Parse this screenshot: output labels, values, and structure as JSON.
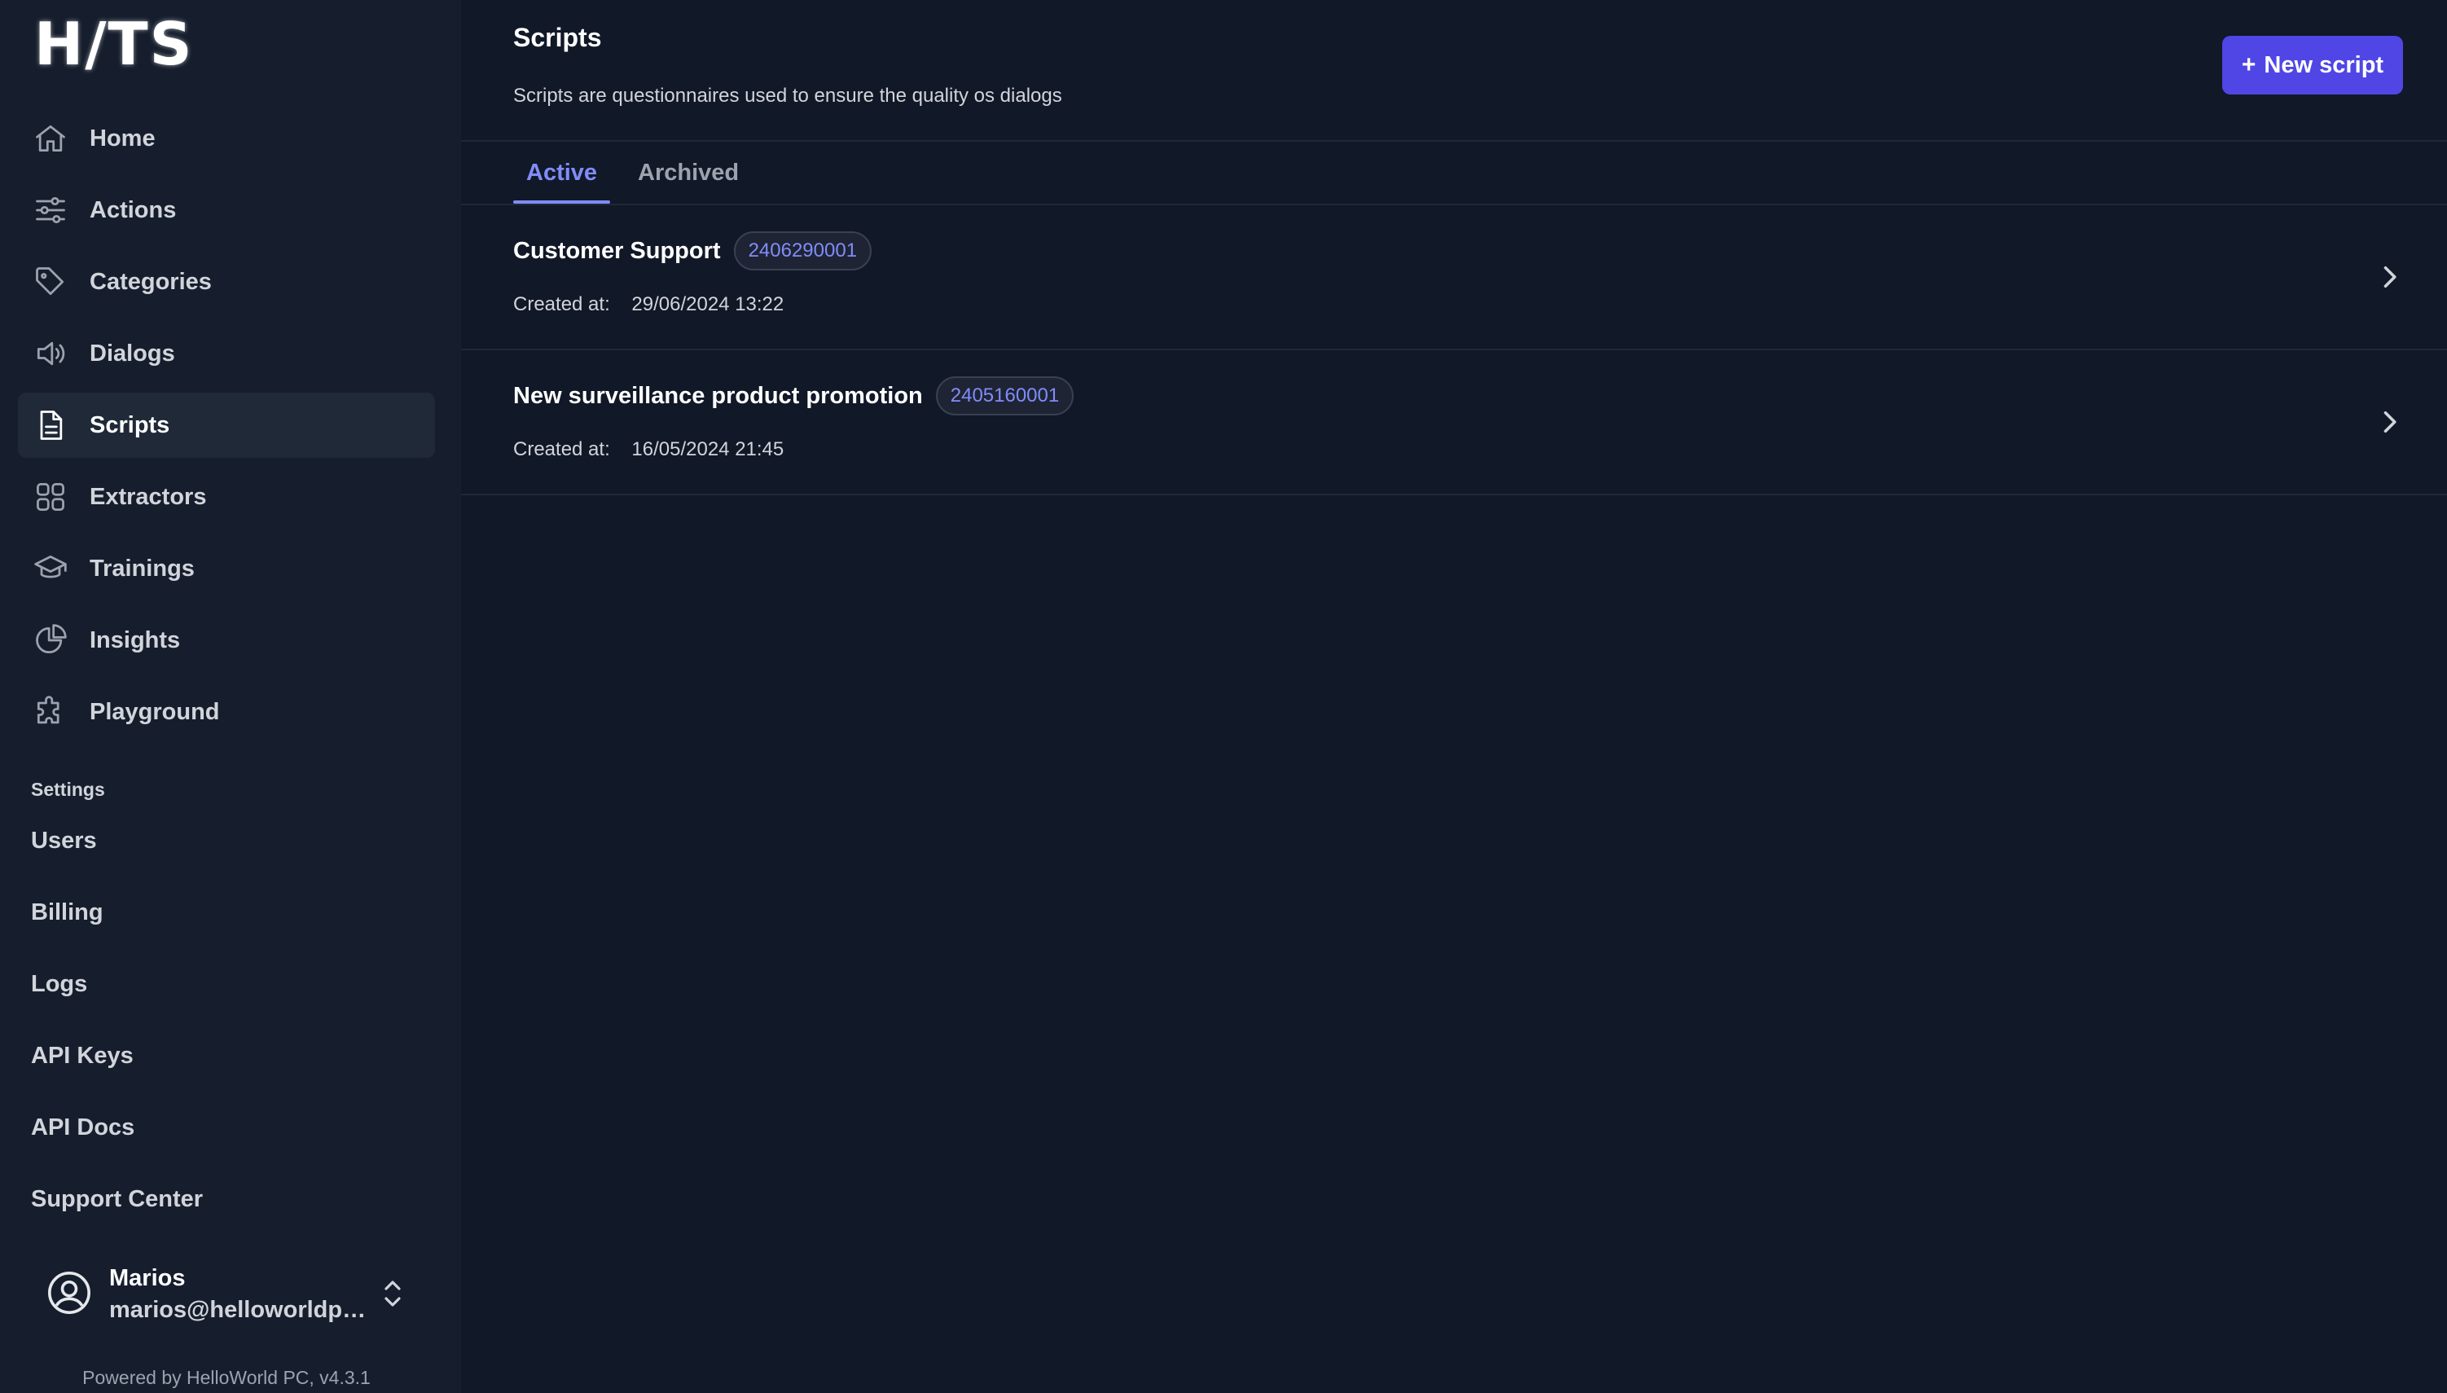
{
  "brand": {
    "logo_text": "H/TS"
  },
  "nav": {
    "items": [
      {
        "label": "Home",
        "icon": "home-icon",
        "active": false
      },
      {
        "label": "Actions",
        "icon": "sliders-icon",
        "active": false
      },
      {
        "label": "Categories",
        "icon": "tag-icon",
        "active": false
      },
      {
        "label": "Dialogs",
        "icon": "speaker-icon",
        "active": false
      },
      {
        "label": "Scripts",
        "icon": "document-icon",
        "active": true
      },
      {
        "label": "Extractors",
        "icon": "grid-icon",
        "active": false
      },
      {
        "label": "Trainings",
        "icon": "academic-cap-icon",
        "active": false
      },
      {
        "label": "Insights",
        "icon": "pie-chart-icon",
        "active": false
      },
      {
        "label": "Playground",
        "icon": "puzzle-icon",
        "active": false
      }
    ]
  },
  "settings": {
    "heading": "Settings",
    "items": [
      "Users",
      "Billing",
      "Logs",
      "API Keys",
      "API Docs",
      "Support Center"
    ]
  },
  "user": {
    "name": "Marios",
    "email": "marios@helloworldpc...."
  },
  "footer": {
    "powered_by": "Powered by HelloWorld PC, v4.3.1"
  },
  "page": {
    "title": "Scripts",
    "description": "Scripts are questionnaires used to ensure the quality os dialogs",
    "new_button": {
      "plus": "+",
      "label": "New script"
    }
  },
  "tabs": [
    {
      "label": "Active",
      "active": true
    },
    {
      "label": "Archived",
      "active": false
    }
  ],
  "scripts": [
    {
      "name": "Customer Support",
      "id": "2406290001",
      "created_label": "Created at:",
      "created_at": "29/06/2024 13:22"
    },
    {
      "name": "New surveillance product promotion",
      "id": "2405160001",
      "created_label": "Created at:",
      "created_at": "16/05/2024 21:45"
    }
  ],
  "colors": {
    "background": "#111827",
    "sidebar": "#161e2d",
    "accent": "#4f46e5",
    "tab_active": "#818cf8"
  }
}
